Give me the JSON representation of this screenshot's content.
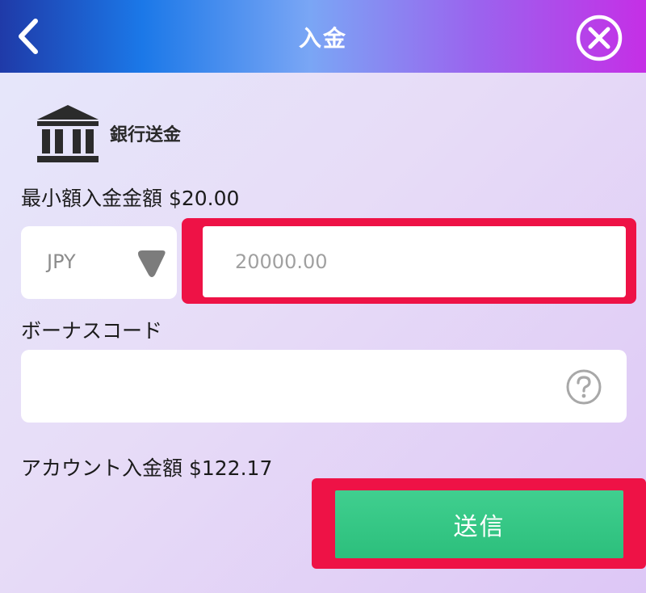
{
  "header": {
    "title": "入金",
    "back_icon": "chevron-left-icon",
    "close_icon": "close-circle-icon"
  },
  "method": {
    "icon": "bank-icon",
    "label": "銀行送金"
  },
  "min_deposit": {
    "label": "最小額入金金額",
    "value": "$20.00"
  },
  "currency": {
    "selected": "JPY",
    "icon": "dropdown-icon"
  },
  "amount": {
    "placeholder": "20000.00"
  },
  "bonus": {
    "label": "ボーナスコード",
    "value": "",
    "help_icon": "question-circle-icon"
  },
  "account_deposit": {
    "label": "アカウント入金額",
    "value": "$122.17"
  },
  "submit": {
    "label": "送信"
  },
  "colors": {
    "highlight": "#ee1246",
    "submit": "#33c583",
    "header_start": "#1f3aa8",
    "header_end": "#c52fe6"
  }
}
